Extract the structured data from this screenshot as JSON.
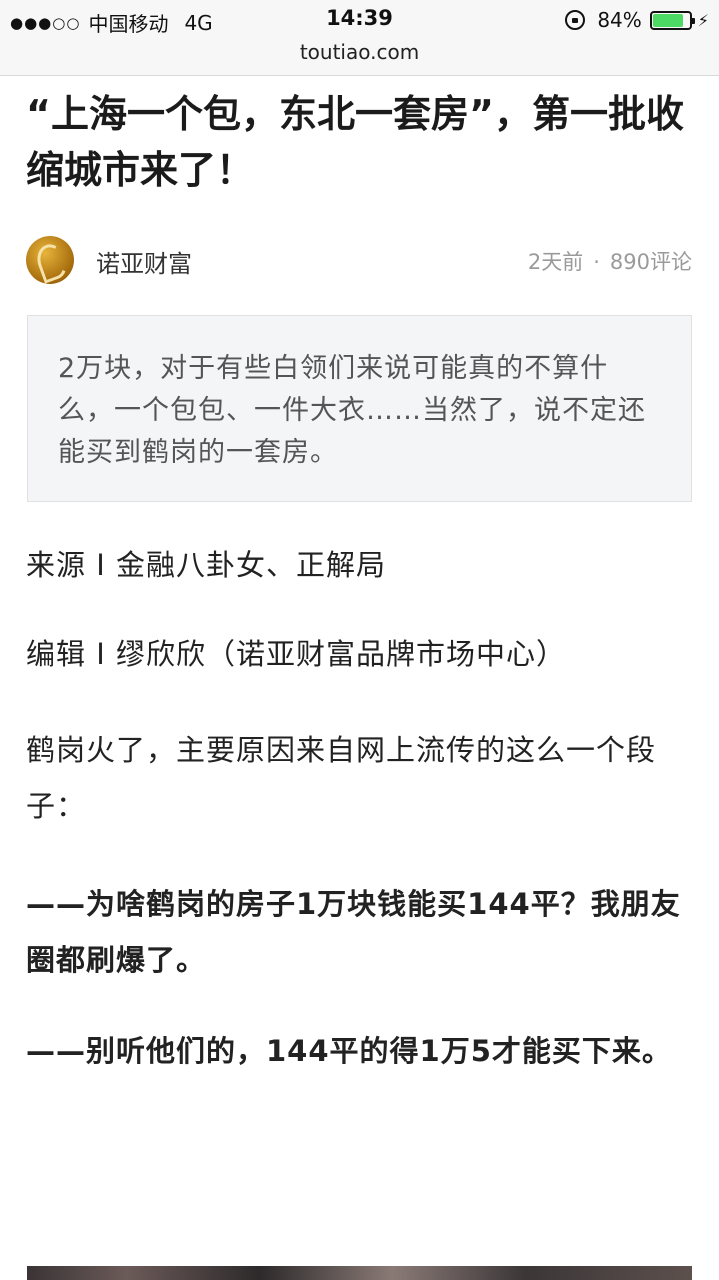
{
  "status_bar": {
    "signal": "●●●○○",
    "carrier": "中国移动",
    "network": "4G",
    "time": "14:39",
    "battery": "84%",
    "battery_level": 0.84,
    "url": "toutiao.com"
  },
  "article": {
    "title": "“上海一个包，东北一套房”，第一批收缩城市来了！",
    "author": "诺亚财富",
    "time_ago": "2天前",
    "separator": "·",
    "comments": "890评论",
    "summary": "2万块，对于有些白领们来说可能真的不算什么，一个包包、一件大衣……当然了，说不定还能买到鹤岗的一套房。",
    "source": "来源 I 金融八卦女、正解局",
    "editor": "编辑 I 缪欣欣（诺亚财富品牌市场中心）",
    "body": "鹤岗火了，主要原因来自网上流传的这么一个段子：",
    "quote_q": "——为啥鹤岗的房子1万块钱能买144平？我朋友圈都刷爆了。",
    "quote_a": "——别听他们的，144平的得1万5才能买下来。"
  }
}
